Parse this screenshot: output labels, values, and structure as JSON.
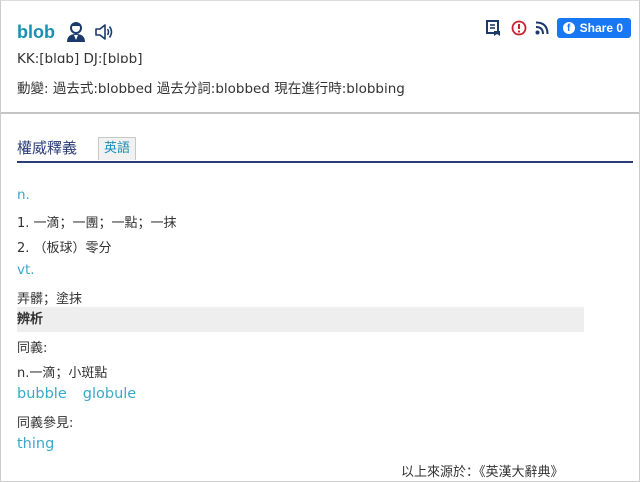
{
  "entry": {
    "word": "blob",
    "pronunciation": "KK:[blɑb] DJ:[blɒb]",
    "forms": "動變: 過去式:blobbed  過去分詞:blobbed  現在進行時:blobbing"
  },
  "toolbar": {
    "share_label": "Share 0"
  },
  "tabs": {
    "main": "權威釋義",
    "english": "英語"
  },
  "definitions": {
    "pos_noun": "n.",
    "noun_1": "1. 一滴；一團；一點；一抹",
    "noun_2": "2. （板球）零分",
    "pos_verb": "vt.",
    "verb_1": "弄髒；塗抹"
  },
  "analysis": {
    "heading": "辨析",
    "synonyms_label": "同義:",
    "synonyms_sense": "n.一滴；小斑點",
    "synonym_links": [
      "bubble",
      "globule"
    ],
    "see_also_label": "同義參見:",
    "see_also_links": [
      "thing"
    ]
  },
  "source": "以上來源於：《英漢大辭典》",
  "colors": {
    "word": "#1a8fb3",
    "link": "#3aa9c7",
    "tab_rule": "#2a3d77",
    "share": "#1877f2",
    "alert": "#cc1f2d"
  }
}
